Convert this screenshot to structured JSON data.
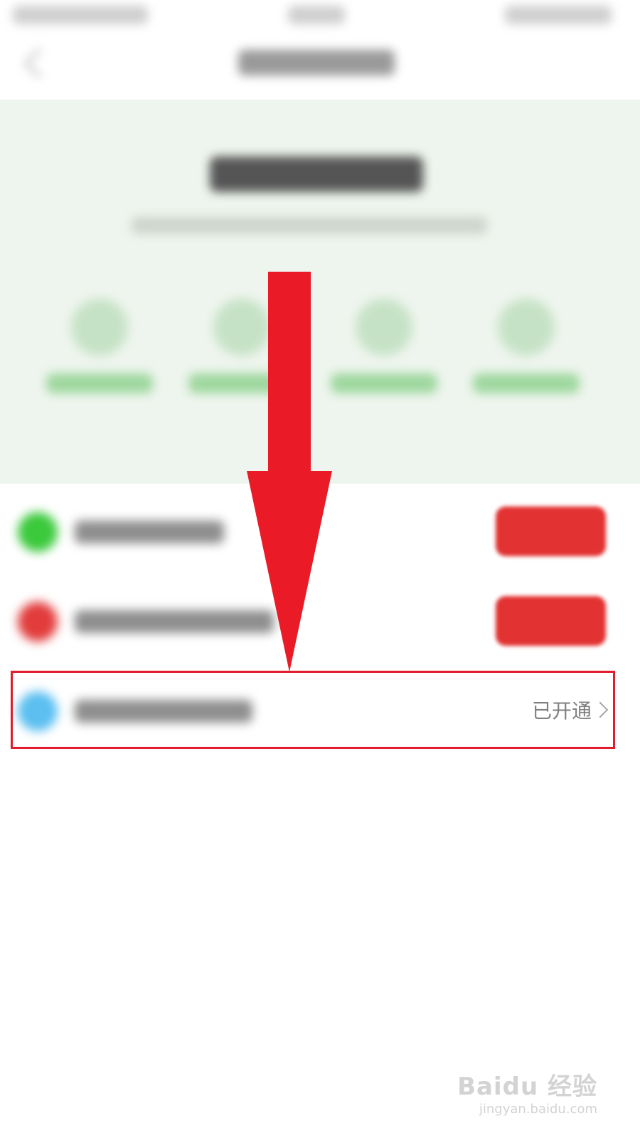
{
  "list": {
    "row3": {
      "status": "已开通"
    }
  },
  "watermark": {
    "logo": "Baidu 经验",
    "url": "jingyan.baidu.com"
  },
  "colors": {
    "accent_red": "#e01c2d",
    "hero_green_bg": "#eef5ee",
    "feature_green": "#9ed79e",
    "row1_icon": "#3cc93c",
    "row2_icon": "#e23c3c",
    "row3_icon": "#5bbff0",
    "button_red": "#e23232"
  },
  "icons": {
    "back": "back-chevron-icon",
    "disclosure": "chevron-right-icon",
    "annotation": "down-arrow-icon"
  }
}
